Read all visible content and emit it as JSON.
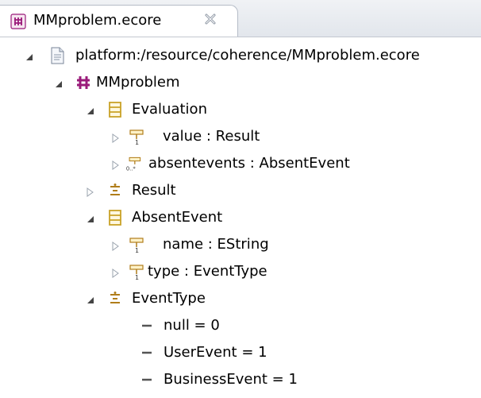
{
  "editor": {
    "tab_title": "MMproblem.ecore",
    "tab_close_icon": "close-icon"
  },
  "tree": {
    "resource": "platform:/resource/coherence/MMproblem.ecore",
    "package": "MMproblem",
    "evaluation": {
      "name": "Evaluation",
      "attributes": [
        "value : Result",
        "absentevents : AbsentEvent"
      ]
    },
    "result": "Result",
    "absent_event": {
      "name": "AbsentEvent",
      "attributes": [
        "name : EString",
        "type : EventType"
      ]
    },
    "event_type": {
      "name": "EventType",
      "literals": [
        "null = 0",
        "UserEvent = 1",
        "BusinessEvent = 1"
      ]
    }
  },
  "colors": {
    "package_icon": "#9a1b7a",
    "class_icon": "#c9a227",
    "attribute_icon": "#b07d1a",
    "literal": "#666666"
  }
}
